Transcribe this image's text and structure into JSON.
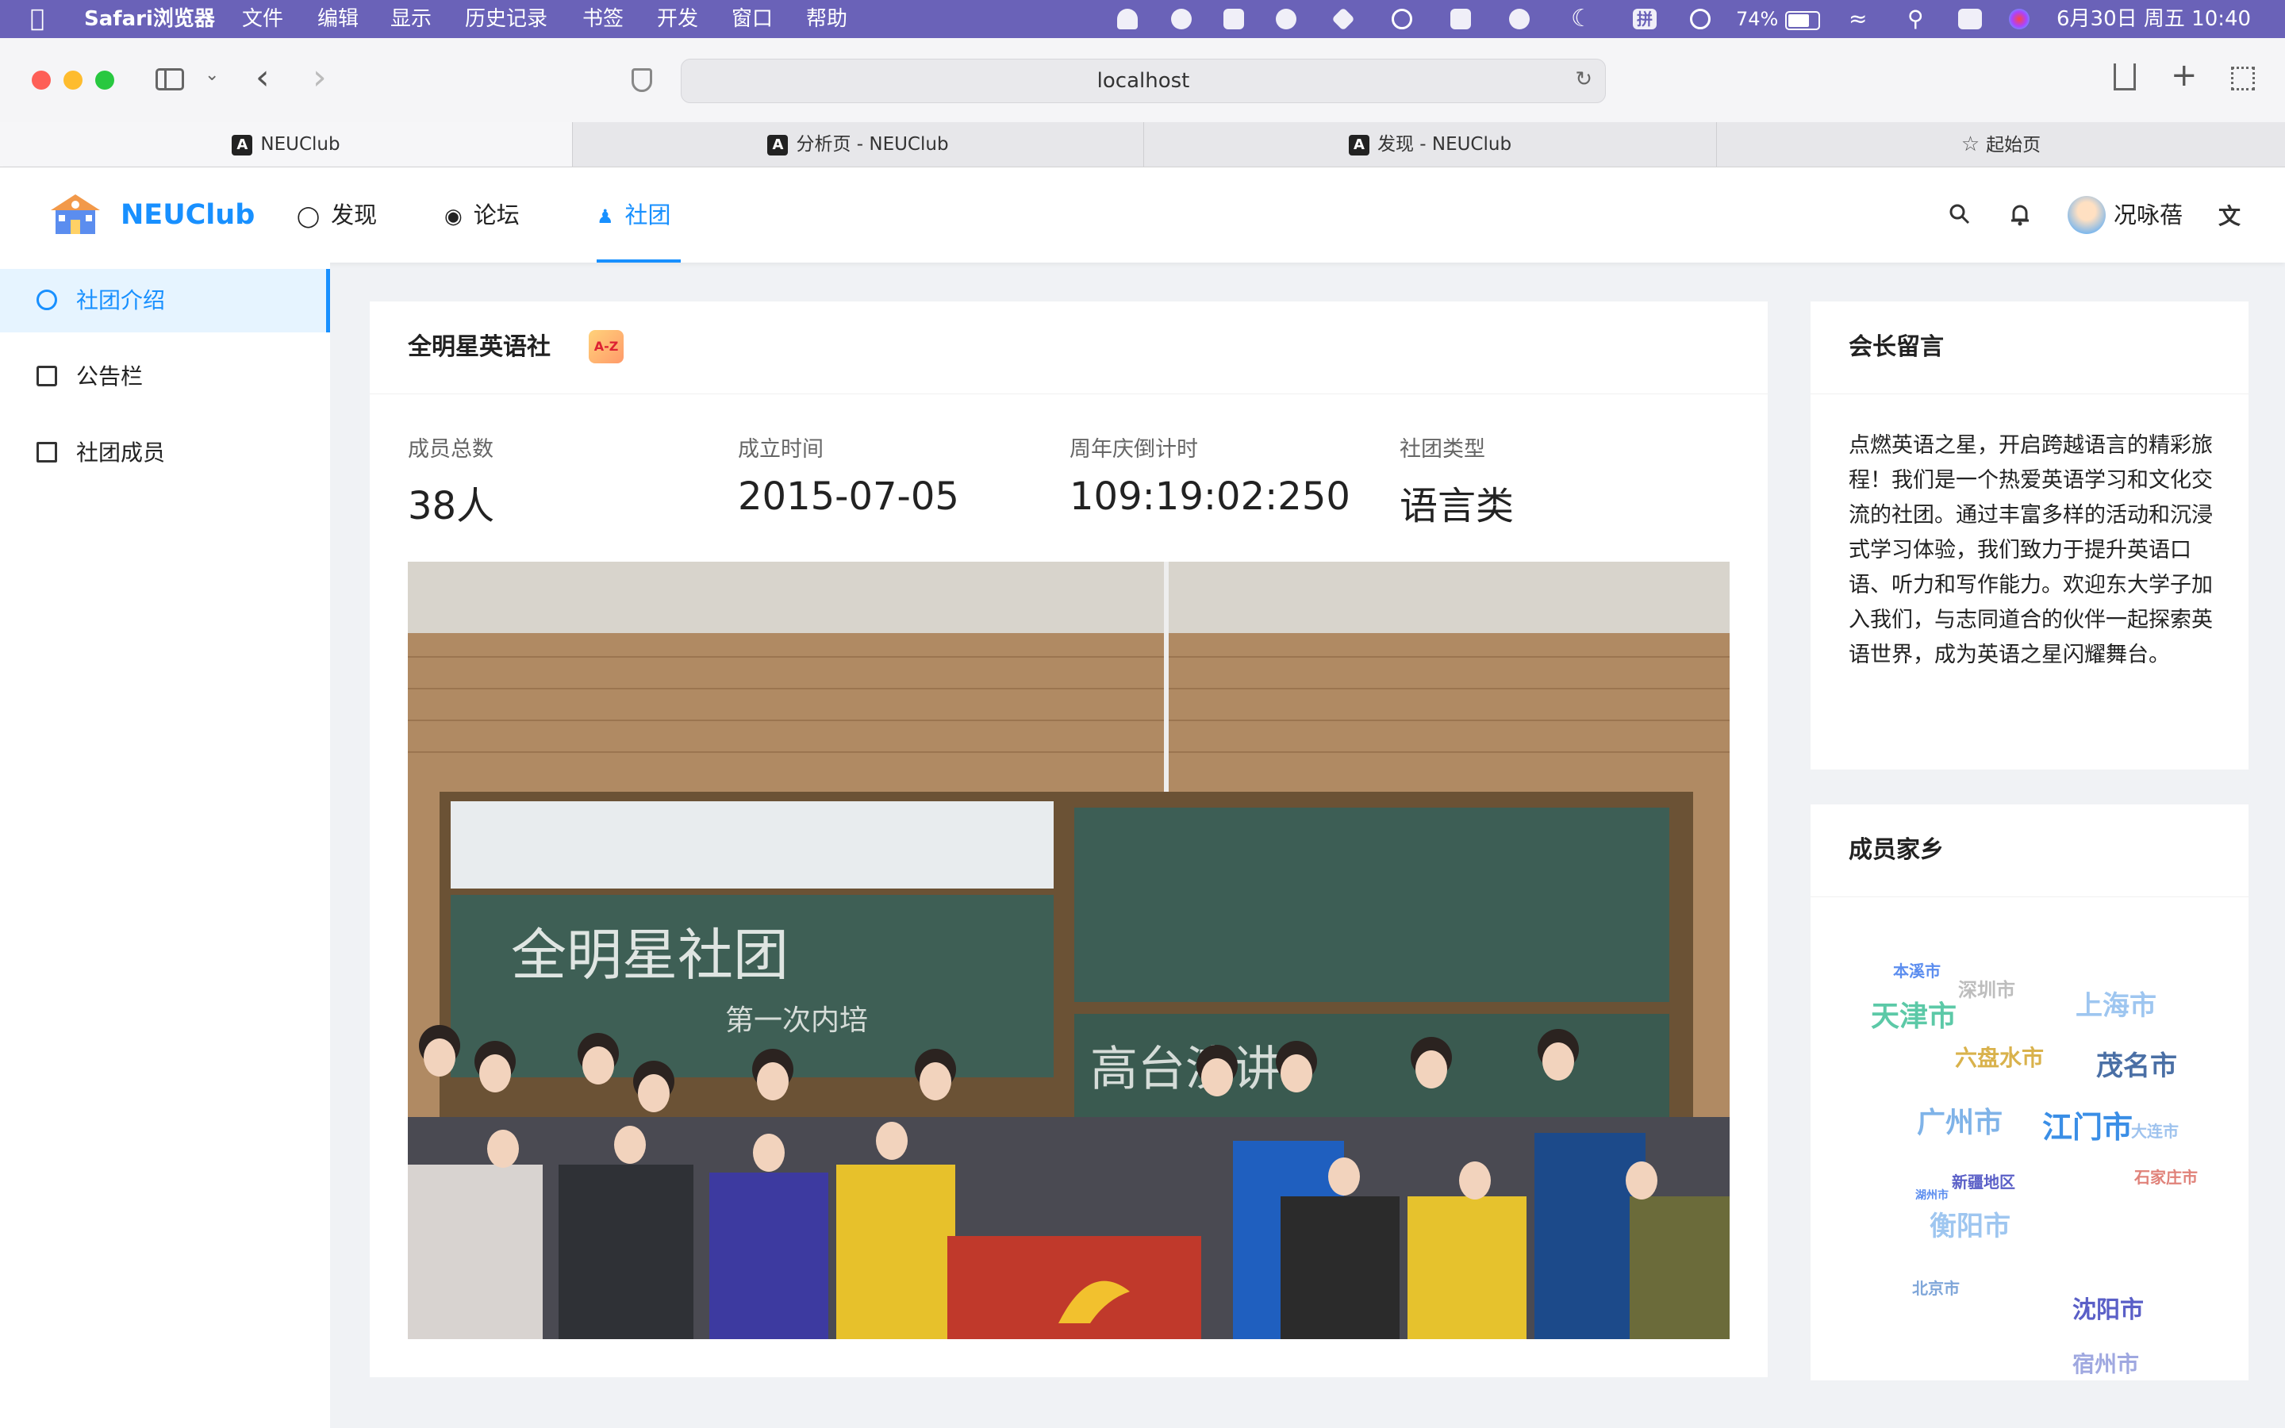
{
  "menubar": {
    "app_name": "Safari浏览器",
    "items": [
      "文件",
      "编辑",
      "显示",
      "历史记录",
      "书签",
      "开发",
      "窗口",
      "帮助"
    ],
    "ime": "拼",
    "battery": "74%",
    "clock": "6月30日 周五 10:40"
  },
  "browser": {
    "url": "localhost",
    "tabs": [
      {
        "label": "NEUClub",
        "active": true
      },
      {
        "label": "分析页 - NEUClub",
        "active": false
      },
      {
        "label": "发现 - NEUClub",
        "active": false
      },
      {
        "label": "起始页",
        "active": false
      }
    ]
  },
  "app": {
    "logo_text": "NEUClub",
    "nav": [
      {
        "label": "发现",
        "icon": "bulb-icon"
      },
      {
        "label": "论坛",
        "icon": "message-icon"
      },
      {
        "label": "社团",
        "icon": "team-icon",
        "active": true
      }
    ],
    "user_name": "况咏蓓",
    "accent_color": "#1890ff"
  },
  "sidebar": {
    "items": [
      {
        "label": "社团介绍",
        "icon": "dashboard-icon",
        "active": true
      },
      {
        "label": "公告栏",
        "icon": "edit-icon"
      },
      {
        "label": "社团成员",
        "icon": "profile-icon"
      }
    ]
  },
  "club": {
    "name": "全明星英语社",
    "stats": [
      {
        "label": "成员总数",
        "value": "38人"
      },
      {
        "label": "成立时间",
        "value": "2015-07-05"
      },
      {
        "label": "周年庆倒计时",
        "value": "109:19:02:250"
      },
      {
        "label": "社团类型",
        "value": "语言类"
      }
    ],
    "photo_chalk_title": "全明星社团",
    "photo_chalk_sub": "第一次内培",
    "photo_chalk_right": "高台演讲"
  },
  "leader_message": {
    "title": "会长留言",
    "text": "点燃英语之星，开启跨越语言的精彩旅程！我们是一个热爱英语学习和文化交流的社团。通过丰富多样的活动和沉浸式学习体验，我们致力于提升英语口语、听力和写作能力。欢迎东大学子加入我们，与志同道合的伙伴一起探索英语世界，成为英语之星闪耀舞台。"
  },
  "hometown": {
    "title": "成员家乡",
    "words": [
      "本溪市",
      "深圳市",
      "天津市",
      "上海市",
      "六盘水市",
      "茂名市",
      "广州市",
      "江门市",
      "大连市",
      "新疆地区",
      "石家庄市",
      "湖州市",
      "衡阳市",
      "北京市",
      "沈阳市",
      "宿州市"
    ]
  }
}
